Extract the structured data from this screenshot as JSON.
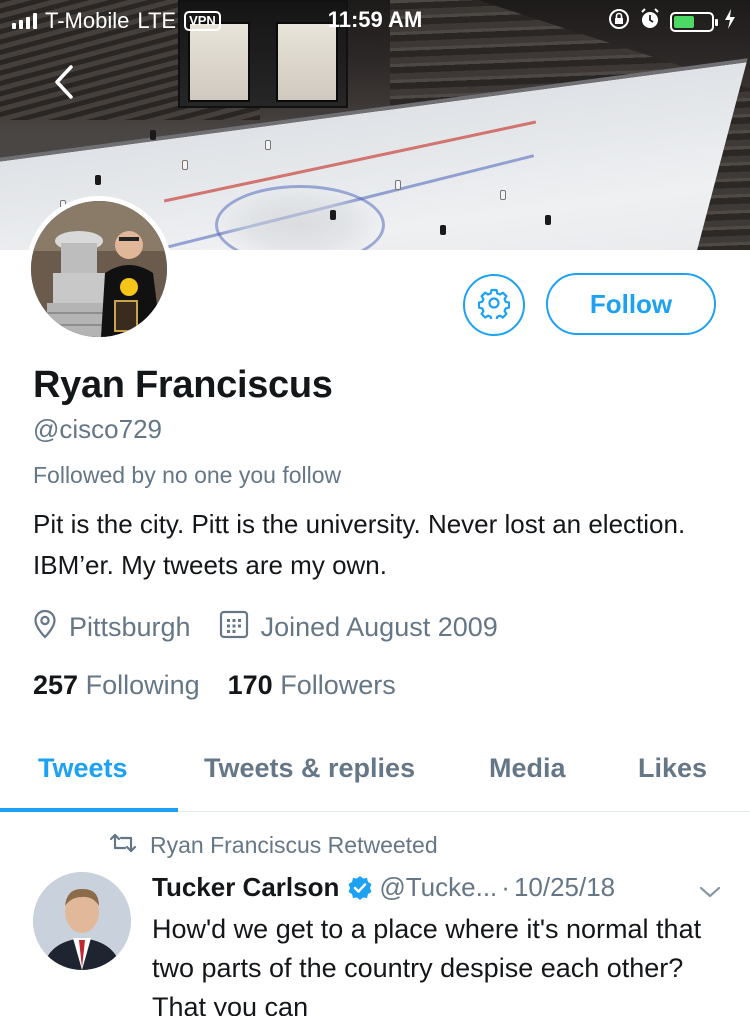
{
  "status_bar": {
    "carrier": "T-Mobile",
    "network": "LTE",
    "vpn_label": "VPN",
    "time": "11:59 AM",
    "battery_level": 0.55
  },
  "profile": {
    "name": "Ryan Franciscus",
    "handle": "@cisco729",
    "followed_by": "Followed by no one you follow",
    "bio": "Pit is the city. Pitt is the university. Never lost an election. IBM’er. My tweets are my own.",
    "location": "Pittsburgh",
    "joined": "Joined August 2009",
    "following_count": "257",
    "following_label": "Following",
    "followers_count": "170",
    "followers_label": "Followers"
  },
  "actions": {
    "follow_label": "Follow",
    "settings_icon": "gear-icon",
    "back_icon": "chevron-left-icon"
  },
  "tabs": [
    {
      "label": "Tweets",
      "active": true
    },
    {
      "label": "Tweets & replies",
      "active": false
    },
    {
      "label": "Media",
      "active": false
    },
    {
      "label": "Likes",
      "active": false
    }
  ],
  "tweet": {
    "retweet_note": "Ryan Franciscus Retweeted",
    "author": "Tucker Carlson",
    "verified": true,
    "handle": "@Tucke...",
    "separator": "·",
    "date": "10/25/18",
    "text": "How'd we get to a place where it's normal that two parts of the country despise each other? That you can"
  },
  "colors": {
    "accent": "#1da1f2",
    "text": "#14171a",
    "secondary": "#657786",
    "border": "#e1e8ed"
  }
}
